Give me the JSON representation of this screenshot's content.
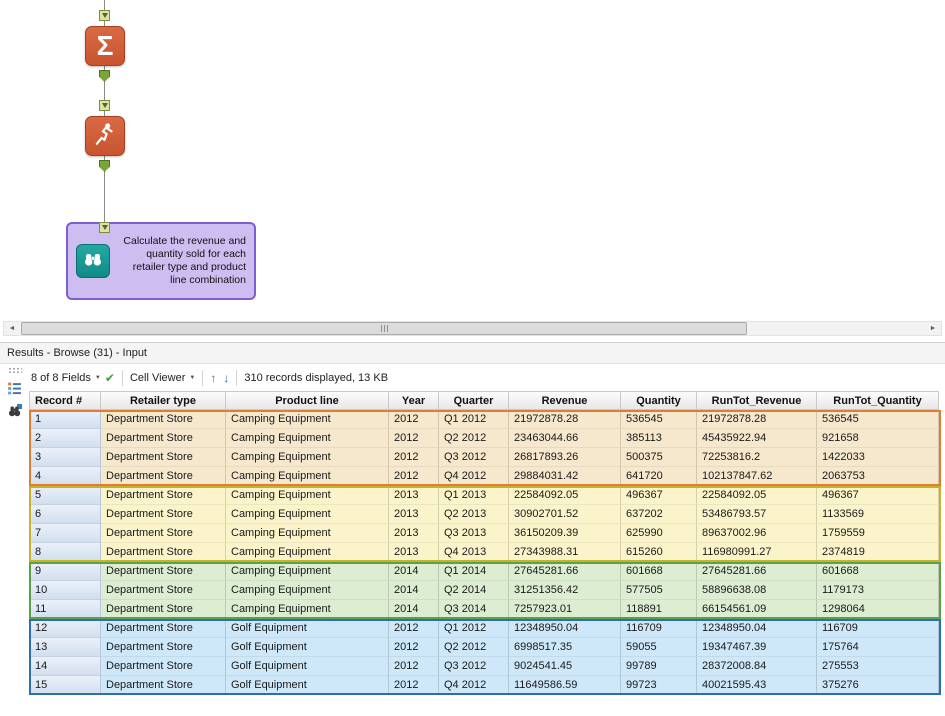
{
  "icons": {
    "dropdown": "▼",
    "check": "✔",
    "up_arrow": "↑",
    "down_arrow": "↓",
    "scroll_left": "◄",
    "scroll_right": "►"
  },
  "canvas": {
    "summarize_symbol": "Σ",
    "browse_annotation": "Calculate the revenue and quantity sold for each retailer type and product line combination"
  },
  "results": {
    "title": "Results - Browse (31) - Input",
    "toolbar": {
      "fields_label": "8 of 8 Fields",
      "cell_viewer_label": "Cell Viewer",
      "records_info": "310 records displayed, 13 KB"
    }
  },
  "table": {
    "columns": [
      "Record #",
      "Retailer type",
      "Product line",
      "Year",
      "Quarter",
      "Revenue",
      "Quantity",
      "RunTot_Revenue",
      "RunTot_Quantity"
    ],
    "groups": [
      {
        "name": "camping-2012",
        "border": "#df7d35",
        "bg": "#f6e8cd",
        "rows": [
          [
            "1",
            "Department Store",
            "Camping Equipment",
            "2012",
            "Q1 2012",
            "21972878.28",
            "536545",
            "21972878.28",
            "536545"
          ],
          [
            "2",
            "Department Store",
            "Camping Equipment",
            "2012",
            "Q2 2012",
            "23463044.66",
            "385113",
            "45435922.94",
            "921658"
          ],
          [
            "3",
            "Department Store",
            "Camping Equipment",
            "2012",
            "Q3 2012",
            "26817893.26",
            "500375",
            "72253816.2",
            "1422033"
          ],
          [
            "4",
            "Department Store",
            "Camping Equipment",
            "2012",
            "Q4 2012",
            "29884031.42",
            "641720",
            "102137847.62",
            "2063753"
          ]
        ]
      },
      {
        "name": "camping-2013",
        "border": "#c9b22a",
        "bg": "#fbf4cb",
        "rows": [
          [
            "5",
            "Department Store",
            "Camping Equipment",
            "2013",
            "Q1 2013",
            "22584092.05",
            "496367",
            "22584092.05",
            "496367"
          ],
          [
            "6",
            "Department Store",
            "Camping Equipment",
            "2013",
            "Q2 2013",
            "30902701.52",
            "637202",
            "53486793.57",
            "1133569"
          ],
          [
            "7",
            "Department Store",
            "Camping Equipment",
            "2013",
            "Q3 2013",
            "36150209.39",
            "625990",
            "89637002.96",
            "1759559"
          ],
          [
            "8",
            "Department Store",
            "Camping Equipment",
            "2013",
            "Q4 2013",
            "27343988.31",
            "615260",
            "116980991.27",
            "2374819"
          ]
        ]
      },
      {
        "name": "camping-2014",
        "border": "#5ba147",
        "bg": "#dcedd2",
        "rows": [
          [
            "9",
            "Department Store",
            "Camping Equipment",
            "2014",
            "Q1 2014",
            "27645281.66",
            "601668",
            "27645281.66",
            "601668"
          ],
          [
            "10",
            "Department Store",
            "Camping Equipment",
            "2014",
            "Q2 2014",
            "31251356.42",
            "577505",
            "58896638.08",
            "1179173"
          ],
          [
            "11",
            "Department Store",
            "Camping Equipment",
            "2014",
            "Q3 2014",
            "7257923.01",
            "118891",
            "66154561.09",
            "1298064"
          ]
        ]
      },
      {
        "name": "golf-2012",
        "border": "#2e6db4",
        "bg": "#cfe8f9",
        "rows": [
          [
            "12",
            "Department Store",
            "Golf Equipment",
            "2012",
            "Q1 2012",
            "12348950.04",
            "116709",
            "12348950.04",
            "116709"
          ],
          [
            "13",
            "Department Store",
            "Golf Equipment",
            "2012",
            "Q2 2012",
            "6998517.35",
            "59055",
            "19347467.39",
            "175764"
          ],
          [
            "14",
            "Department Store",
            "Golf Equipment",
            "2012",
            "Q3 2012",
            "9024541.45",
            "99789",
            "28372008.84",
            "275553"
          ],
          [
            "15",
            "Department Store",
            "Golf Equipment",
            "2012",
            "Q4 2012",
            "11649586.59",
            "99723",
            "40021595.43",
            "375276"
          ]
        ]
      }
    ]
  }
}
